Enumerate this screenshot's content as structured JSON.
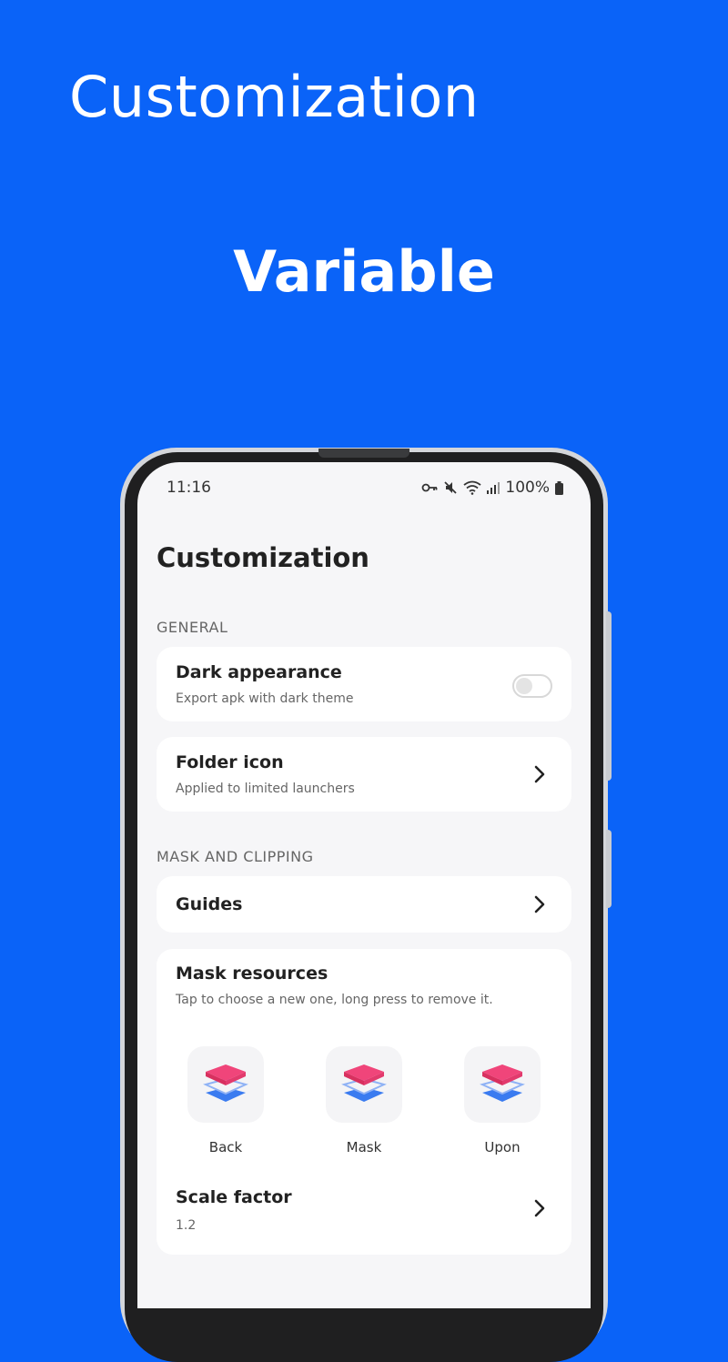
{
  "hero": {
    "title": "Customization",
    "subtitle": "Variable"
  },
  "statusbar": {
    "time": "11:16",
    "battery": "100%",
    "icons": [
      "key-icon",
      "mute-icon",
      "wifi-icon",
      "signal-icon",
      "battery-icon"
    ]
  },
  "screen": {
    "title": "Customization",
    "sections": {
      "general": "GENERAL",
      "mask": "MASK AND CLIPPING"
    },
    "dark_appearance": {
      "title": "Dark appearance",
      "subtitle": "Export apk with dark theme",
      "enabled": false
    },
    "folder_icon": {
      "title": "Folder icon",
      "subtitle": "Applied to limited launchers"
    },
    "guides": {
      "title": "Guides"
    },
    "mask_resources": {
      "title": "Mask resources",
      "subtitle": "Tap to choose a new one, long press to remove it.",
      "items": [
        {
          "label": "Back"
        },
        {
          "label": "Mask"
        },
        {
          "label": "Upon"
        }
      ]
    },
    "scale_factor": {
      "title": "Scale factor",
      "value": "1.2"
    }
  },
  "colors": {
    "background": "#0a63f8",
    "screen": "#f6f6f8",
    "card": "#ffffff",
    "layer_pink": "#f0457a",
    "layer_blue": "#3a7bf0"
  }
}
